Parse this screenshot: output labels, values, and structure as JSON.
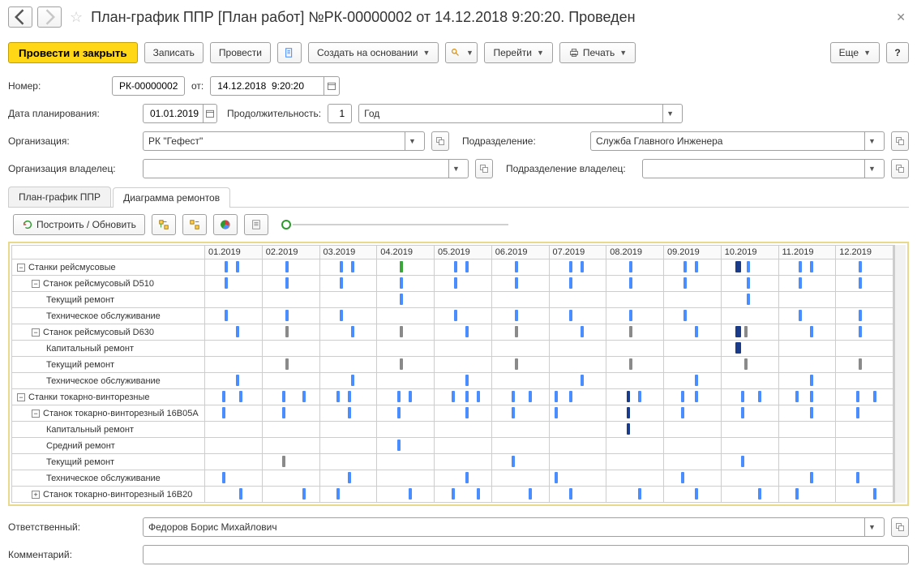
{
  "header": {
    "title": "План-график ППР [План работ] №РК-00000002 от 14.12.2018 9:20:20. Проведен"
  },
  "toolbar": {
    "conduct_close": "Провести и закрыть",
    "save": "Записать",
    "conduct": "Провести",
    "create_based": "Создать на основании",
    "goto": "Перейти",
    "print": "Печать",
    "more": "Еще",
    "help": "?"
  },
  "form": {
    "number_label": "Номер:",
    "number": "РК-00000002",
    "from_label": "от:",
    "date": "14.12.2018  9:20:20",
    "plan_date_label": "Дата планирования:",
    "plan_date": "01.01.2019",
    "duration_label": "Продолжительность:",
    "duration": "1",
    "duration_unit": "Год",
    "org_label": "Организация:",
    "org": "РК \"Гефест\"",
    "dept_label": "Подразделение:",
    "dept": "Служба Главного Инженера",
    "org_owner_label": "Организация владелец:",
    "org_owner": "",
    "dept_owner_label": "Подразделение владелец:",
    "dept_owner": "",
    "responsible_label": "Ответственный:",
    "responsible": "Федоров Борис Михайлович",
    "comment_label": "Комментарий:",
    "comment": ""
  },
  "tabs": {
    "plan": "План-график ППР",
    "diagram": "Диаграмма ремонтов"
  },
  "sub_toolbar": {
    "build": "Построить / Обновить"
  },
  "months": [
    "01.2019",
    "02.2019",
    "03.2019",
    "04.2019",
    "05.2019",
    "06.2019",
    "07.2019",
    "08.2019",
    "09.2019",
    "10.2019",
    "11.2019",
    "12.2019"
  ],
  "rows": [
    {
      "level": 0,
      "toggle": "−",
      "label": "Станки рейсмусовые",
      "bars": [
        [
          0,
          35,
          "blue"
        ],
        [
          0,
          55,
          "blue"
        ],
        [
          1,
          40,
          "blue"
        ],
        [
          2,
          35,
          "blue"
        ],
        [
          2,
          55,
          "blue"
        ],
        [
          3,
          40,
          "blue"
        ],
        [
          3,
          40,
          "green"
        ],
        [
          4,
          35,
          "blue"
        ],
        [
          4,
          55,
          "blue"
        ],
        [
          5,
          40,
          "blue"
        ],
        [
          6,
          35,
          "blue"
        ],
        [
          6,
          55,
          "blue"
        ],
        [
          7,
          40,
          "blue"
        ],
        [
          8,
          35,
          "blue"
        ],
        [
          8,
          55,
          "blue"
        ],
        [
          9,
          25,
          "darkblue",
          "wide"
        ],
        [
          9,
          45,
          "blue"
        ],
        [
          10,
          35,
          "blue"
        ],
        [
          10,
          55,
          "blue"
        ],
        [
          11,
          40,
          "blue"
        ]
      ]
    },
    {
      "level": 1,
      "toggle": "−",
      "label": "Станок рейсмусовый D510",
      "bars": [
        [
          0,
          35,
          "blue"
        ],
        [
          1,
          40,
          "blue"
        ],
        [
          2,
          35,
          "blue"
        ],
        [
          3,
          40,
          "blue"
        ],
        [
          4,
          35,
          "blue"
        ],
        [
          5,
          40,
          "blue"
        ],
        [
          6,
          35,
          "blue"
        ],
        [
          7,
          40,
          "blue"
        ],
        [
          8,
          35,
          "blue"
        ],
        [
          9,
          45,
          "blue"
        ],
        [
          10,
          35,
          "blue"
        ],
        [
          11,
          40,
          "blue"
        ]
      ]
    },
    {
      "level": 2,
      "label": "Текущий ремонт",
      "bars": [
        [
          3,
          40,
          "blue"
        ],
        [
          9,
          45,
          "blue"
        ]
      ]
    },
    {
      "level": 2,
      "label": "Техническое обслуживание",
      "bars": [
        [
          0,
          35,
          "blue"
        ],
        [
          1,
          40,
          "blue"
        ],
        [
          2,
          35,
          "blue"
        ],
        [
          4,
          35,
          "blue"
        ],
        [
          5,
          40,
          "blue"
        ],
        [
          6,
          35,
          "blue"
        ],
        [
          7,
          40,
          "blue"
        ],
        [
          8,
          35,
          "blue"
        ],
        [
          10,
          35,
          "blue"
        ],
        [
          11,
          40,
          "blue"
        ]
      ]
    },
    {
      "level": 1,
      "toggle": "−",
      "label": "Станок рейсмусовый D630",
      "bars": [
        [
          0,
          55,
          "blue"
        ],
        [
          1,
          40,
          "gray"
        ],
        [
          2,
          55,
          "blue"
        ],
        [
          3,
          40,
          "gray"
        ],
        [
          4,
          55,
          "blue"
        ],
        [
          5,
          40,
          "gray"
        ],
        [
          6,
          55,
          "blue"
        ],
        [
          7,
          40,
          "gray"
        ],
        [
          8,
          55,
          "blue"
        ],
        [
          9,
          25,
          "darkblue",
          "wide"
        ],
        [
          9,
          40,
          "gray"
        ],
        [
          10,
          55,
          "blue"
        ],
        [
          11,
          40,
          "blue"
        ]
      ]
    },
    {
      "level": 2,
      "label": "Капитальный ремонт",
      "bars": [
        [
          9,
          25,
          "darkblue",
          "wide"
        ]
      ]
    },
    {
      "level": 2,
      "label": "Текущий ремонт",
      "bars": [
        [
          1,
          40,
          "gray"
        ],
        [
          3,
          40,
          "gray"
        ],
        [
          5,
          40,
          "gray"
        ],
        [
          7,
          40,
          "gray"
        ],
        [
          9,
          40,
          "gray"
        ],
        [
          11,
          40,
          "gray"
        ]
      ]
    },
    {
      "level": 2,
      "label": "Техническое обслуживание",
      "bars": [
        [
          0,
          55,
          "blue"
        ],
        [
          2,
          55,
          "blue"
        ],
        [
          4,
          55,
          "blue"
        ],
        [
          6,
          55,
          "blue"
        ],
        [
          8,
          55,
          "blue"
        ],
        [
          10,
          55,
          "blue"
        ]
      ]
    },
    {
      "level": 0,
      "toggle": "−",
      "label": "Станки токарно-винторезные",
      "bars": [
        [
          0,
          30,
          "blue"
        ],
        [
          0,
          60,
          "blue"
        ],
        [
          1,
          35,
          "blue"
        ],
        [
          1,
          70,
          "blue"
        ],
        [
          2,
          30,
          "blue"
        ],
        [
          2,
          50,
          "blue"
        ],
        [
          3,
          35,
          "blue"
        ],
        [
          3,
          55,
          "blue"
        ],
        [
          4,
          30,
          "blue"
        ],
        [
          4,
          55,
          "blue"
        ],
        [
          4,
          75,
          "blue"
        ],
        [
          5,
          35,
          "blue"
        ],
        [
          5,
          65,
          "blue"
        ],
        [
          6,
          10,
          "blue"
        ],
        [
          6,
          35,
          "blue"
        ],
        [
          7,
          35,
          "darkblue"
        ],
        [
          7,
          55,
          "blue"
        ],
        [
          8,
          30,
          "blue"
        ],
        [
          8,
          55,
          "blue"
        ],
        [
          9,
          35,
          "blue"
        ],
        [
          9,
          65,
          "blue"
        ],
        [
          10,
          30,
          "blue"
        ],
        [
          10,
          55,
          "blue"
        ],
        [
          11,
          35,
          "blue"
        ],
        [
          11,
          65,
          "blue"
        ]
      ]
    },
    {
      "level": 1,
      "toggle": "−",
      "label": "Станок токарно-винторезный 16В05А",
      "bars": [
        [
          0,
          30,
          "blue"
        ],
        [
          1,
          35,
          "blue"
        ],
        [
          2,
          50,
          "blue"
        ],
        [
          3,
          35,
          "blue"
        ],
        [
          4,
          55,
          "blue"
        ],
        [
          5,
          35,
          "blue"
        ],
        [
          6,
          10,
          "blue"
        ],
        [
          7,
          35,
          "darkblue"
        ],
        [
          8,
          30,
          "blue"
        ],
        [
          9,
          35,
          "blue"
        ],
        [
          10,
          55,
          "blue"
        ],
        [
          11,
          35,
          "blue"
        ]
      ]
    },
    {
      "level": 2,
      "label": "Капитальный ремонт",
      "bars": [
        [
          7,
          35,
          "darkblue"
        ]
      ]
    },
    {
      "level": 2,
      "label": "Средний ремонт",
      "bars": [
        [
          3,
          35,
          "blue"
        ]
      ]
    },
    {
      "level": 2,
      "label": "Текущий ремонт",
      "bars": [
        [
          1,
          35,
          "gray"
        ],
        [
          5,
          35,
          "blue"
        ],
        [
          9,
          35,
          "blue"
        ]
      ]
    },
    {
      "level": 2,
      "label": "Техническое обслуживание",
      "bars": [
        [
          0,
          30,
          "blue"
        ],
        [
          2,
          50,
          "blue"
        ],
        [
          4,
          55,
          "blue"
        ],
        [
          6,
          10,
          "blue"
        ],
        [
          8,
          30,
          "blue"
        ],
        [
          10,
          55,
          "blue"
        ],
        [
          11,
          35,
          "blue"
        ]
      ]
    },
    {
      "level": 1,
      "toggle": "+",
      "label": "Станок токарно-винторезный 16В20",
      "bars": [
        [
          0,
          60,
          "blue"
        ],
        [
          1,
          70,
          "blue"
        ],
        [
          2,
          30,
          "blue"
        ],
        [
          3,
          55,
          "blue"
        ],
        [
          4,
          30,
          "blue"
        ],
        [
          4,
          75,
          "blue"
        ],
        [
          5,
          65,
          "blue"
        ],
        [
          6,
          35,
          "blue"
        ],
        [
          7,
          55,
          "blue"
        ],
        [
          8,
          55,
          "blue"
        ],
        [
          9,
          65,
          "blue"
        ],
        [
          10,
          30,
          "blue"
        ],
        [
          11,
          65,
          "blue"
        ]
      ]
    }
  ]
}
